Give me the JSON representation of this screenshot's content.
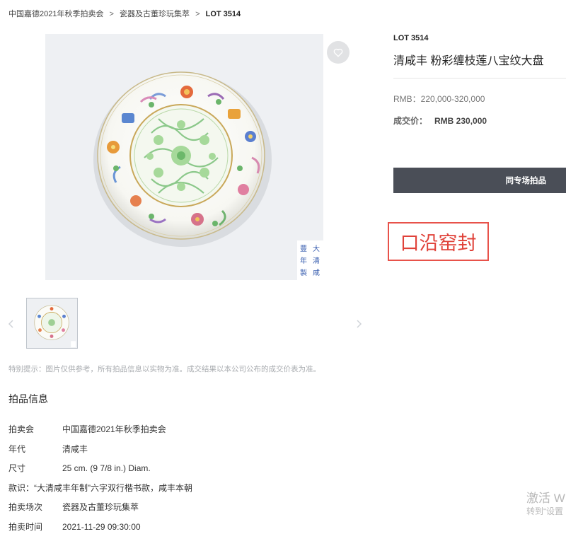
{
  "breadcrumb": {
    "items": [
      "中国嘉德2021年秋季拍卖会",
      "瓷器及古董珍玩集萃"
    ],
    "separator": ">",
    "current": "LOT 3514"
  },
  "gallery": {
    "reign_mark": [
      "大",
      "清",
      "咸",
      "豐",
      "年",
      "製"
    ],
    "favorite_icon": "heart-outline-icon",
    "prev_icon": "chevron-left-icon",
    "next_icon": "chevron-right-icon"
  },
  "notice": "特别提示：图片仅供参考，所有拍品信息以实物为准。成交结果以本公司公布的成交价表为准。",
  "info": {
    "title": "拍品信息",
    "rows": [
      {
        "key": "拍卖会",
        "value": "中国嘉德2021年秋季拍卖会"
      },
      {
        "key": "年代",
        "value": "清咸丰"
      },
      {
        "key": "尺寸",
        "value": "25 cm. (9 7/8 in.) Diam."
      },
      {
        "key": "",
        "value": "款识：“大清咸丰年制”六字双行楷书款，咸丰本朝"
      },
      {
        "key": "拍卖场次",
        "value": "瓷器及古董珍玩集萃"
      },
      {
        "key": "拍卖时间",
        "value": "2021-11-29 09:30:00"
      }
    ]
  },
  "lot": {
    "number": "LOT 3514",
    "title": "清咸丰 粉彩缠枝莲八宝纹大盘",
    "estimate": "RMB：220,000-320,000",
    "sold_label": "成交价：",
    "sold_value": "RMB 230,000",
    "session_button": "同专场拍品"
  },
  "annotation": "口沿窑封",
  "watermark": {
    "line1": "激活 W",
    "line2": "转到“设置"
  },
  "colors": {
    "button_bg": "#4a4e57",
    "annotation_red": "#e8524a",
    "image_bg": "#eef0f3"
  }
}
